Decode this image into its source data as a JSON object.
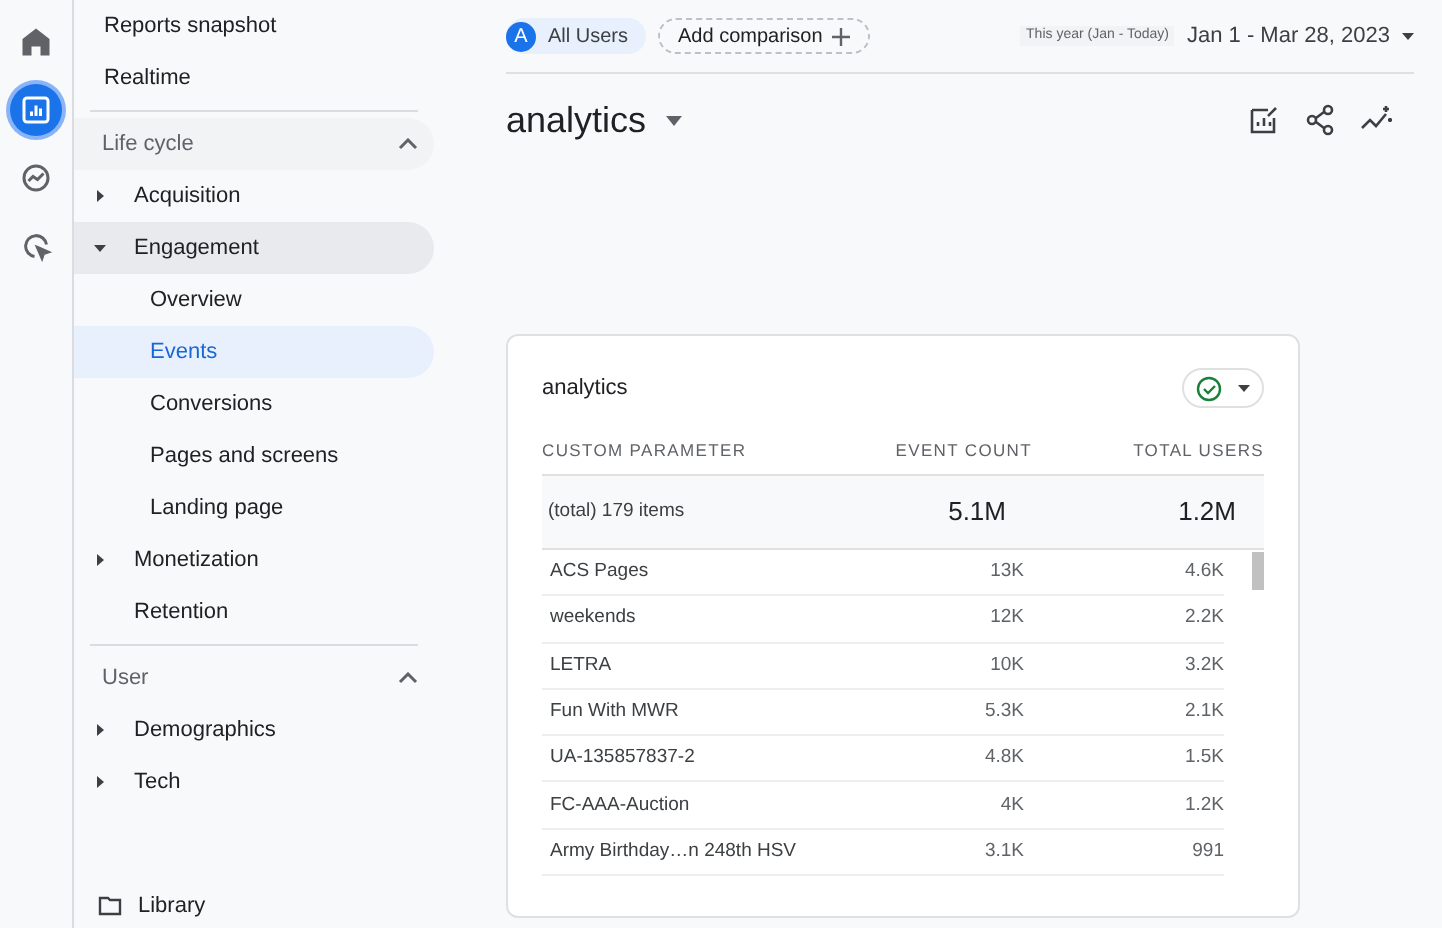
{
  "rail": [
    {
      "kind": "home",
      "selected": false
    },
    {
      "kind": "reports",
      "selected": true
    },
    {
      "kind": "explore",
      "selected": false
    },
    {
      "kind": "advertising",
      "selected": false
    }
  ],
  "nav_top": [
    {
      "label": "Reports snapshot"
    },
    {
      "label": "Realtime"
    }
  ],
  "sections": [
    {
      "label": "Life cycle",
      "expanded": true,
      "items": [
        {
          "label": "Acquisition",
          "expanded": false
        },
        {
          "label": "Engagement",
          "expanded": true,
          "children": [
            {
              "label": "Overview",
              "selected": false
            },
            {
              "label": "Events",
              "selected": true
            },
            {
              "label": "Conversions",
              "selected": false
            },
            {
              "label": "Pages and screens",
              "selected": false
            },
            {
              "label": "Landing page",
              "selected": false
            }
          ]
        },
        {
          "label": "Monetization",
          "expanded": false
        },
        {
          "label": "Retention"
        }
      ]
    },
    {
      "label": "User",
      "expanded": true,
      "items": [
        {
          "label": "Demographics",
          "expanded": false
        },
        {
          "label": "Tech",
          "expanded": false
        }
      ]
    }
  ],
  "library": {
    "label": "Library"
  },
  "top_bar": {
    "segment_badge": "A",
    "segment": "All Users",
    "add_comparison": "Add comparison",
    "date_hint": "This year (Jan - Today)",
    "date_range": "Jan 1 - Mar 28, 2023"
  },
  "page_title": "analytics",
  "card": {
    "title": "analytics",
    "columns": [
      "CUSTOM PARAMETER",
      "EVENT COUNT",
      "TOTAL USERS"
    ],
    "total": {
      "label": "(total) 179 items",
      "event_count": "5.1M",
      "total_users": "1.2M"
    },
    "rows": [
      {
        "name": "ACS Pages",
        "event_count": "13K",
        "total_users": "4.6K"
      },
      {
        "name": "weekends",
        "event_count": "12K",
        "total_users": "2.2K"
      },
      {
        "name": "LETRA",
        "event_count": "10K",
        "total_users": "3.2K"
      },
      {
        "name": "Fun With MWR",
        "event_count": "5.3K",
        "total_users": "2.1K"
      },
      {
        "name": "UA-135857837-2",
        "event_count": "4.8K",
        "total_users": "1.5K"
      },
      {
        "name": "FC-AAA-Auction",
        "event_count": "4K",
        "total_users": "1.2K"
      },
      {
        "name": "Army Birthday…n 248th HSV",
        "event_count": "3.1K",
        "total_users": "991"
      }
    ]
  }
}
